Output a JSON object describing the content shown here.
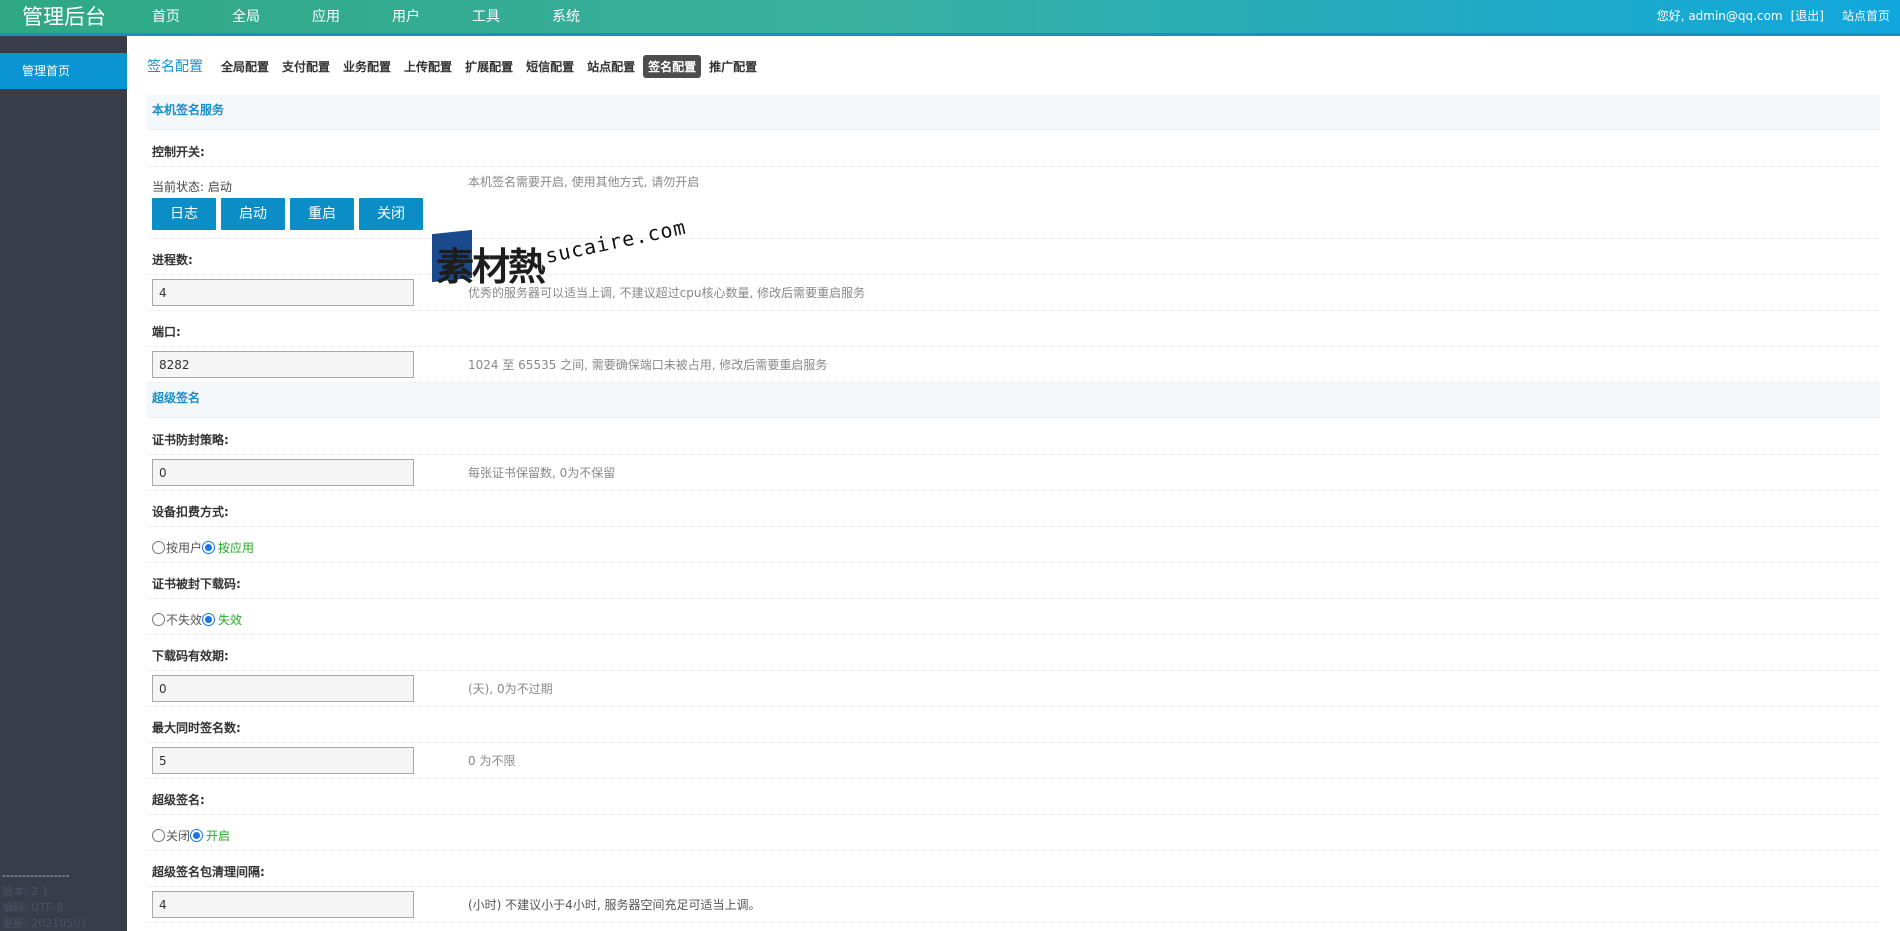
{
  "app": {
    "title": "管理后台",
    "nav": [
      "首页",
      "全局",
      "应用",
      "用户",
      "工具",
      "系统"
    ],
    "greeting": "您好, admin@qq.com",
    "logout": "[退出]",
    "site_home": "站点首页"
  },
  "sidebar": {
    "active_item": "管理首页",
    "footer": {
      "divider": "-----------------",
      "version": "版本: 2.1",
      "encoding": "编码: UTF-8",
      "updated": "更新: 20210501"
    }
  },
  "tabs": {
    "lead": "签名配置",
    "items": [
      "全局配置",
      "支付配置",
      "业务配置",
      "上传配置",
      "扩展配置",
      "短信配置",
      "站点配置",
      "签名配置",
      "推广配置"
    ],
    "active": "签名配置"
  },
  "local_service": {
    "title": "本机签名服务",
    "switch_label": "控制开关:",
    "status_text": "当前状态: 启动",
    "status_hint": "本机签名需要开启, 使用其他方式, 请勿开启",
    "buttons": [
      "日志",
      "启动",
      "重启",
      "关闭"
    ],
    "process_label": "进程数:",
    "process_value": "4",
    "process_hint": "优秀的服务器可以适当上调, 不建议超过cpu核心数量, 修改后需要重启服务",
    "port_label": "端口:",
    "port_value": "8282",
    "port_hint": "1024 至 65535 之间, 需要确保端口未被占用, 修改后需要重启服务"
  },
  "super_sign": {
    "title": "超级签名",
    "cert_policy_label": "证书防封策略:",
    "cert_policy_value": "0",
    "cert_policy_hint": "每张证书保留数, 0为不保留",
    "billing_label": "设备扣费方式:",
    "billing_options": [
      "按用户",
      "按应用"
    ],
    "billing_selected": "按应用",
    "cert_banned_label": "证书被封下载码:",
    "cert_banned_options": [
      "不失效",
      "失效"
    ],
    "cert_banned_selected": "失效",
    "code_valid_label": "下载码有效期:",
    "code_valid_value": "0",
    "code_valid_hint": "(天), 0为不过期",
    "max_concurrent_label": "最大同时签名数:",
    "max_concurrent_value": "5",
    "max_concurrent_hint": "0 为不限",
    "super_sign_label": "超级签名:",
    "super_sign_options": [
      "关闭",
      "开启"
    ],
    "super_sign_selected": "开启",
    "cleanup_label": "超级签名包清理间隔:",
    "cleanup_value": "4",
    "cleanup_hint": "(小时) 不建议小于4小时, 服务器空间充足可适当上调。"
  },
  "watermark": {
    "brand": "素材熱",
    "domain": "sucaire.com"
  },
  "colors": {
    "accent": "#0b8ec6",
    "sidebar_bg": "#393d49",
    "link": "#1a8fcb",
    "on_green": "#2aa82a"
  }
}
